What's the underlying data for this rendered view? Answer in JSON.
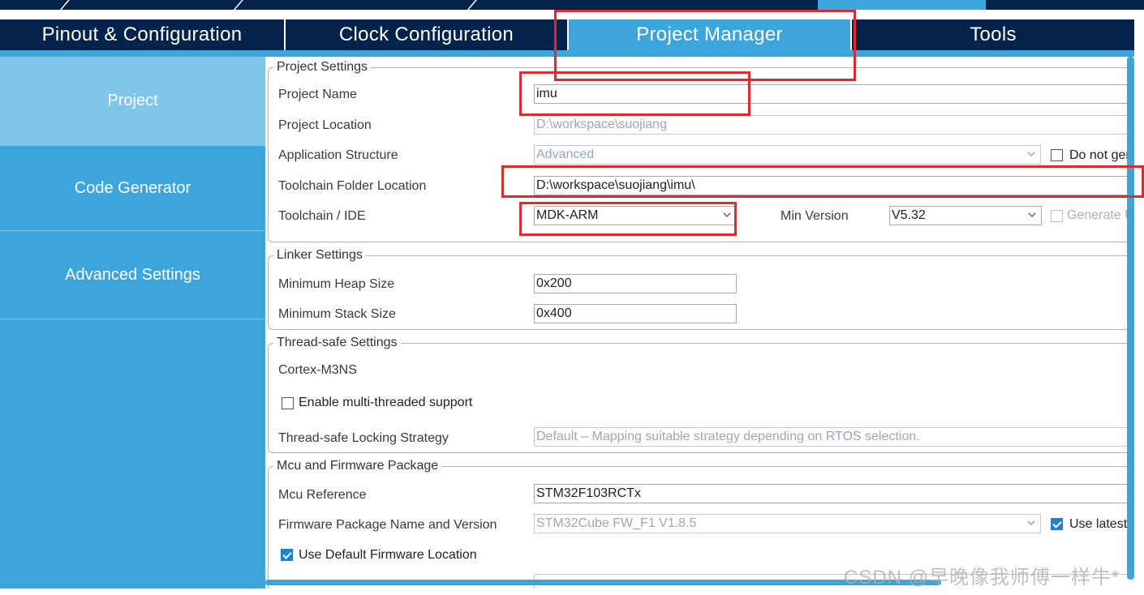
{
  "tabs": [
    {
      "label": "Pinout & Configuration",
      "active": false
    },
    {
      "label": "Clock Configuration",
      "active": false
    },
    {
      "label": "Project Manager",
      "active": true
    },
    {
      "label": "Tools",
      "active": false
    }
  ],
  "sidebar": {
    "items": [
      {
        "label": "Project",
        "active": true
      },
      {
        "label": "Code Generator",
        "active": false
      },
      {
        "label": "Advanced Settings",
        "active": false
      }
    ]
  },
  "project_settings": {
    "title": "Project Settings",
    "project_name_label": "Project Name",
    "project_name_value": "imu",
    "project_location_label": "Project Location",
    "project_location_value": "D:\\workspace\\suojiang",
    "app_structure_label": "Application Structure",
    "app_structure_value": "Advanced",
    "do_not_generate_label": "Do not ger",
    "toolchain_folder_label": "Toolchain Folder Location",
    "toolchain_folder_value": "D:\\workspace\\suojiang\\imu\\",
    "toolchain_ide_label": "Toolchain / IDE",
    "toolchain_ide_value": "MDK-ARM",
    "min_version_label": "Min Version",
    "min_version_value": "V5.32",
    "generate_label": "Generate U"
  },
  "linker_settings": {
    "title": "Linker Settings",
    "heap_label": "Minimum Heap Size",
    "heap_value": "0x200",
    "stack_label": "Minimum Stack Size",
    "stack_value": "0x400"
  },
  "thread_safe": {
    "title": "Thread-safe Settings",
    "core_label": "Cortex-M3NS",
    "multi_thread_label": "Enable multi-threaded support",
    "multi_thread_checked": false,
    "locking_label": "Thread-safe Locking Strategy",
    "locking_value": "Default  –  Mapping suitable strategy depending on RTOS selection."
  },
  "firmware": {
    "title": "Mcu and Firmware Package",
    "mcu_ref_label": "Mcu Reference",
    "mcu_ref_value": "STM32F103RCTx",
    "fw_name_label": "Firmware Package Name and Version",
    "fw_name_value": "STM32Cube FW_F1 V1.8.5",
    "use_latest_label": "Use latest",
    "use_latest_checked": true,
    "use_default_location_label": "Use Default Firmware Location",
    "use_default_location_checked": true
  },
  "watermark": "CSDN @早晚像我师傅一样牛*",
  "colors": {
    "dark_navy": "#03234b",
    "accent_blue": "#3ca5dc",
    "sidebar_active": "#7fc7ea",
    "annotation_red": "#e8242c",
    "check_blue": "#1a82d4"
  }
}
